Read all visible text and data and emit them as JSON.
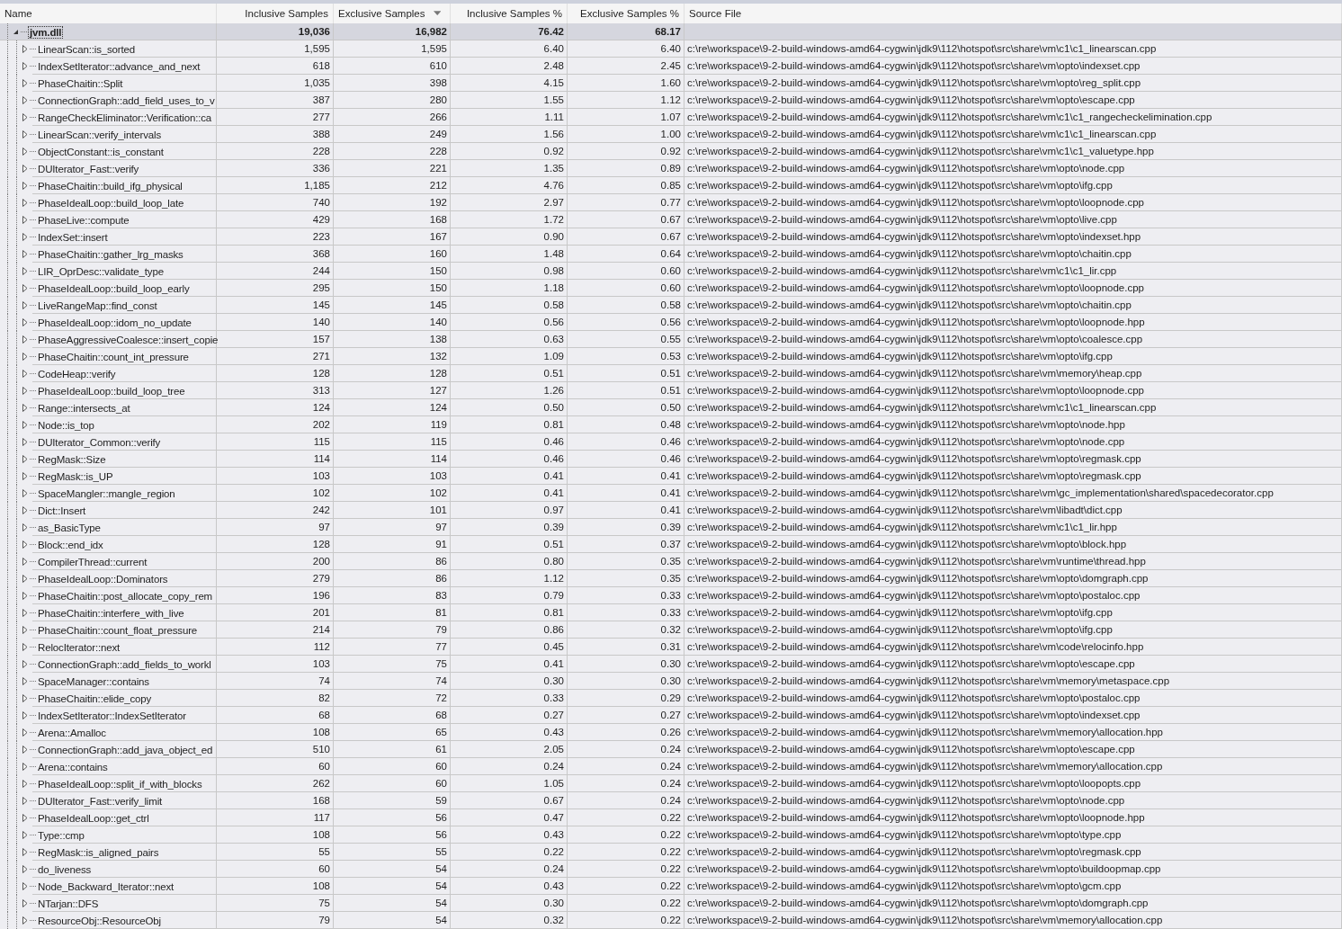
{
  "table": {
    "columns": [
      {
        "label": "Name",
        "sorted": false
      },
      {
        "label": "Inclusive Samples",
        "sorted": false
      },
      {
        "label": "Exclusive Samples",
        "sorted": true
      },
      {
        "label": "Inclusive Samples %",
        "sorted": false
      },
      {
        "label": "Exclusive Samples %",
        "sorted": false
      },
      {
        "label": "Source File",
        "sorted": false
      }
    ],
    "rows": [
      {
        "cells": [
          "jvm.dll",
          "19,036",
          "16,982",
          "76.42",
          "68.17",
          ""
        ],
        "expanded": true,
        "selected": true,
        "children": [
          {
            "cells": [
              "LinearScan::is_sorted",
              "1,595",
              "1,595",
              "6.40",
              "6.40",
              "c:\\re\\workspace\\9-2-build-windows-amd64-cygwin\\jdk9\\112\\hotspot\\src\\share\\vm\\c1\\c1_linearscan.cpp"
            ],
            "expanded": false,
            "selected": false
          },
          {
            "cells": [
              "IndexSetIterator::advance_and_next",
              "618",
              "610",
              "2.48",
              "2.45",
              "c:\\re\\workspace\\9-2-build-windows-amd64-cygwin\\jdk9\\112\\hotspot\\src\\share\\vm\\opto\\indexset.cpp"
            ],
            "expanded": false,
            "selected": false
          },
          {
            "cells": [
              "PhaseChaitin::Split",
              "1,035",
              "398",
              "4.15",
              "1.60",
              "c:\\re\\workspace\\9-2-build-windows-amd64-cygwin\\jdk9\\112\\hotspot\\src\\share\\vm\\opto\\reg_split.cpp"
            ],
            "expanded": false,
            "selected": false
          },
          {
            "cells": [
              "ConnectionGraph::add_field_uses_to_v",
              "387",
              "280",
              "1.55",
              "1.12",
              "c:\\re\\workspace\\9-2-build-windows-amd64-cygwin\\jdk9\\112\\hotspot\\src\\share\\vm\\opto\\escape.cpp"
            ],
            "expanded": false,
            "selected": false
          },
          {
            "cells": [
              "RangeCheckEliminator::Verification::ca",
              "277",
              "266",
              "1.11",
              "1.07",
              "c:\\re\\workspace\\9-2-build-windows-amd64-cygwin\\jdk9\\112\\hotspot\\src\\share\\vm\\c1\\c1_rangecheckelimination.cpp"
            ],
            "expanded": false,
            "selected": false
          },
          {
            "cells": [
              "LinearScan::verify_intervals",
              "388",
              "249",
              "1.56",
              "1.00",
              "c:\\re\\workspace\\9-2-build-windows-amd64-cygwin\\jdk9\\112\\hotspot\\src\\share\\vm\\c1\\c1_linearscan.cpp"
            ],
            "expanded": false,
            "selected": false
          },
          {
            "cells": [
              "ObjectConstant::is_constant",
              "228",
              "228",
              "0.92",
              "0.92",
              "c:\\re\\workspace\\9-2-build-windows-amd64-cygwin\\jdk9\\112\\hotspot\\src\\share\\vm\\c1\\c1_valuetype.hpp"
            ],
            "expanded": false,
            "selected": false
          },
          {
            "cells": [
              "DUIterator_Fast::verify",
              "336",
              "221",
              "1.35",
              "0.89",
              "c:\\re\\workspace\\9-2-build-windows-amd64-cygwin\\jdk9\\112\\hotspot\\src\\share\\vm\\opto\\node.cpp"
            ],
            "expanded": false,
            "selected": false
          },
          {
            "cells": [
              "PhaseChaitin::build_ifg_physical",
              "1,185",
              "212",
              "4.76",
              "0.85",
              "c:\\re\\workspace\\9-2-build-windows-amd64-cygwin\\jdk9\\112\\hotspot\\src\\share\\vm\\opto\\ifg.cpp"
            ],
            "expanded": false,
            "selected": false
          },
          {
            "cells": [
              "PhaseIdealLoop::build_loop_late",
              "740",
              "192",
              "2.97",
              "0.77",
              "c:\\re\\workspace\\9-2-build-windows-amd64-cygwin\\jdk9\\112\\hotspot\\src\\share\\vm\\opto\\loopnode.cpp"
            ],
            "expanded": false,
            "selected": false
          },
          {
            "cells": [
              "PhaseLive::compute",
              "429",
              "168",
              "1.72",
              "0.67",
              "c:\\re\\workspace\\9-2-build-windows-amd64-cygwin\\jdk9\\112\\hotspot\\src\\share\\vm\\opto\\live.cpp"
            ],
            "expanded": false,
            "selected": false
          },
          {
            "cells": [
              "IndexSet::insert",
              "223",
              "167",
              "0.90",
              "0.67",
              "c:\\re\\workspace\\9-2-build-windows-amd64-cygwin\\jdk9\\112\\hotspot\\src\\share\\vm\\opto\\indexset.hpp"
            ],
            "expanded": false,
            "selected": false
          },
          {
            "cells": [
              "PhaseChaitin::gather_lrg_masks",
              "368",
              "160",
              "1.48",
              "0.64",
              "c:\\re\\workspace\\9-2-build-windows-amd64-cygwin\\jdk9\\112\\hotspot\\src\\share\\vm\\opto\\chaitin.cpp"
            ],
            "expanded": false,
            "selected": false
          },
          {
            "cells": [
              "LIR_OprDesc::validate_type",
              "244",
              "150",
              "0.98",
              "0.60",
              "c:\\re\\workspace\\9-2-build-windows-amd64-cygwin\\jdk9\\112\\hotspot\\src\\share\\vm\\c1\\c1_lir.cpp"
            ],
            "expanded": false,
            "selected": false
          },
          {
            "cells": [
              "PhaseIdealLoop::build_loop_early",
              "295",
              "150",
              "1.18",
              "0.60",
              "c:\\re\\workspace\\9-2-build-windows-amd64-cygwin\\jdk9\\112\\hotspot\\src\\share\\vm\\opto\\loopnode.cpp"
            ],
            "expanded": false,
            "selected": false
          },
          {
            "cells": [
              "LiveRangeMap::find_const",
              "145",
              "145",
              "0.58",
              "0.58",
              "c:\\re\\workspace\\9-2-build-windows-amd64-cygwin\\jdk9\\112\\hotspot\\src\\share\\vm\\opto\\chaitin.cpp"
            ],
            "expanded": false,
            "selected": false
          },
          {
            "cells": [
              "PhaseIdealLoop::idom_no_update",
              "140",
              "140",
              "0.56",
              "0.56",
              "c:\\re\\workspace\\9-2-build-windows-amd64-cygwin\\jdk9\\112\\hotspot\\src\\share\\vm\\opto\\loopnode.hpp"
            ],
            "expanded": false,
            "selected": false
          },
          {
            "cells": [
              "PhaseAggressiveCoalesce::insert_copie",
              "157",
              "138",
              "0.63",
              "0.55",
              "c:\\re\\workspace\\9-2-build-windows-amd64-cygwin\\jdk9\\112\\hotspot\\src\\share\\vm\\opto\\coalesce.cpp"
            ],
            "expanded": false,
            "selected": false
          },
          {
            "cells": [
              "PhaseChaitin::count_int_pressure",
              "271",
              "132",
              "1.09",
              "0.53",
              "c:\\re\\workspace\\9-2-build-windows-amd64-cygwin\\jdk9\\112\\hotspot\\src\\share\\vm\\opto\\ifg.cpp"
            ],
            "expanded": false,
            "selected": false
          },
          {
            "cells": [
              "CodeHeap::verify",
              "128",
              "128",
              "0.51",
              "0.51",
              "c:\\re\\workspace\\9-2-build-windows-amd64-cygwin\\jdk9\\112\\hotspot\\src\\share\\vm\\memory\\heap.cpp"
            ],
            "expanded": false,
            "selected": false
          },
          {
            "cells": [
              "PhaseIdealLoop::build_loop_tree",
              "313",
              "127",
              "1.26",
              "0.51",
              "c:\\re\\workspace\\9-2-build-windows-amd64-cygwin\\jdk9\\112\\hotspot\\src\\share\\vm\\opto\\loopnode.cpp"
            ],
            "expanded": false,
            "selected": false
          },
          {
            "cells": [
              "Range::intersects_at",
              "124",
              "124",
              "0.50",
              "0.50",
              "c:\\re\\workspace\\9-2-build-windows-amd64-cygwin\\jdk9\\112\\hotspot\\src\\share\\vm\\c1\\c1_linearscan.cpp"
            ],
            "expanded": false,
            "selected": false
          },
          {
            "cells": [
              "Node::is_top",
              "202",
              "119",
              "0.81",
              "0.48",
              "c:\\re\\workspace\\9-2-build-windows-amd64-cygwin\\jdk9\\112\\hotspot\\src\\share\\vm\\opto\\node.hpp"
            ],
            "expanded": false,
            "selected": false
          },
          {
            "cells": [
              "DUIterator_Common::verify",
              "115",
              "115",
              "0.46",
              "0.46",
              "c:\\re\\workspace\\9-2-build-windows-amd64-cygwin\\jdk9\\112\\hotspot\\src\\share\\vm\\opto\\node.cpp"
            ],
            "expanded": false,
            "selected": false
          },
          {
            "cells": [
              "RegMask::Size",
              "114",
              "114",
              "0.46",
              "0.46",
              "c:\\re\\workspace\\9-2-build-windows-amd64-cygwin\\jdk9\\112\\hotspot\\src\\share\\vm\\opto\\regmask.cpp"
            ],
            "expanded": false,
            "selected": false
          },
          {
            "cells": [
              "RegMask::is_UP",
              "103",
              "103",
              "0.41",
              "0.41",
              "c:\\re\\workspace\\9-2-build-windows-amd64-cygwin\\jdk9\\112\\hotspot\\src\\share\\vm\\opto\\regmask.cpp"
            ],
            "expanded": false,
            "selected": false
          },
          {
            "cells": [
              "SpaceMangler::mangle_region",
              "102",
              "102",
              "0.41",
              "0.41",
              "c:\\re\\workspace\\9-2-build-windows-amd64-cygwin\\jdk9\\112\\hotspot\\src\\share\\vm\\gc_implementation\\shared\\spacedecorator.cpp"
            ],
            "expanded": false,
            "selected": false
          },
          {
            "cells": [
              "Dict::Insert",
              "242",
              "101",
              "0.97",
              "0.41",
              "c:\\re\\workspace\\9-2-build-windows-amd64-cygwin\\jdk9\\112\\hotspot\\src\\share\\vm\\libadt\\dict.cpp"
            ],
            "expanded": false,
            "selected": false
          },
          {
            "cells": [
              "as_BasicType",
              "97",
              "97",
              "0.39",
              "0.39",
              "c:\\re\\workspace\\9-2-build-windows-amd64-cygwin\\jdk9\\112\\hotspot\\src\\share\\vm\\c1\\c1_lir.hpp"
            ],
            "expanded": false,
            "selected": false
          },
          {
            "cells": [
              "Block::end_idx",
              "128",
              "91",
              "0.51",
              "0.37",
              "c:\\re\\workspace\\9-2-build-windows-amd64-cygwin\\jdk9\\112\\hotspot\\src\\share\\vm\\opto\\block.hpp"
            ],
            "expanded": false,
            "selected": false
          },
          {
            "cells": [
              "CompilerThread::current",
              "200",
              "86",
              "0.80",
              "0.35",
              "c:\\re\\workspace\\9-2-build-windows-amd64-cygwin\\jdk9\\112\\hotspot\\src\\share\\vm\\runtime\\thread.hpp"
            ],
            "expanded": false,
            "selected": false
          },
          {
            "cells": [
              "PhaseIdealLoop::Dominators",
              "279",
              "86",
              "1.12",
              "0.35",
              "c:\\re\\workspace\\9-2-build-windows-amd64-cygwin\\jdk9\\112\\hotspot\\src\\share\\vm\\opto\\domgraph.cpp"
            ],
            "expanded": false,
            "selected": false
          },
          {
            "cells": [
              "PhaseChaitin::post_allocate_copy_rem",
              "196",
              "83",
              "0.79",
              "0.33",
              "c:\\re\\workspace\\9-2-build-windows-amd64-cygwin\\jdk9\\112\\hotspot\\src\\share\\vm\\opto\\postaloc.cpp"
            ],
            "expanded": false,
            "selected": false
          },
          {
            "cells": [
              "PhaseChaitin::interfere_with_live",
              "201",
              "81",
              "0.81",
              "0.33",
              "c:\\re\\workspace\\9-2-build-windows-amd64-cygwin\\jdk9\\112\\hotspot\\src\\share\\vm\\opto\\ifg.cpp"
            ],
            "expanded": false,
            "selected": false
          },
          {
            "cells": [
              "PhaseChaitin::count_float_pressure",
              "214",
              "79",
              "0.86",
              "0.32",
              "c:\\re\\workspace\\9-2-build-windows-amd64-cygwin\\jdk9\\112\\hotspot\\src\\share\\vm\\opto\\ifg.cpp"
            ],
            "expanded": false,
            "selected": false
          },
          {
            "cells": [
              "RelocIterator::next",
              "112",
              "77",
              "0.45",
              "0.31",
              "c:\\re\\workspace\\9-2-build-windows-amd64-cygwin\\jdk9\\112\\hotspot\\src\\share\\vm\\code\\relocinfo.hpp"
            ],
            "expanded": false,
            "selected": false
          },
          {
            "cells": [
              "ConnectionGraph::add_fields_to_workl",
              "103",
              "75",
              "0.41",
              "0.30",
              "c:\\re\\workspace\\9-2-build-windows-amd64-cygwin\\jdk9\\112\\hotspot\\src\\share\\vm\\opto\\escape.cpp"
            ],
            "expanded": false,
            "selected": false
          },
          {
            "cells": [
              "SpaceManager::contains",
              "74",
              "74",
              "0.30",
              "0.30",
              "c:\\re\\workspace\\9-2-build-windows-amd64-cygwin\\jdk9\\112\\hotspot\\src\\share\\vm\\memory\\metaspace.cpp"
            ],
            "expanded": false,
            "selected": false
          },
          {
            "cells": [
              "PhaseChaitin::elide_copy",
              "82",
              "72",
              "0.33",
              "0.29",
              "c:\\re\\workspace\\9-2-build-windows-amd64-cygwin\\jdk9\\112\\hotspot\\src\\share\\vm\\opto\\postaloc.cpp"
            ],
            "expanded": false,
            "selected": false
          },
          {
            "cells": [
              "IndexSetIterator::IndexSetIterator",
              "68",
              "68",
              "0.27",
              "0.27",
              "c:\\re\\workspace\\9-2-build-windows-amd64-cygwin\\jdk9\\112\\hotspot\\src\\share\\vm\\opto\\indexset.cpp"
            ],
            "expanded": false,
            "selected": false
          },
          {
            "cells": [
              "Arena::Amalloc",
              "108",
              "65",
              "0.43",
              "0.26",
              "c:\\re\\workspace\\9-2-build-windows-amd64-cygwin\\jdk9\\112\\hotspot\\src\\share\\vm\\memory\\allocation.hpp"
            ],
            "expanded": false,
            "selected": false
          },
          {
            "cells": [
              "ConnectionGraph::add_java_object_ed",
              "510",
              "61",
              "2.05",
              "0.24",
              "c:\\re\\workspace\\9-2-build-windows-amd64-cygwin\\jdk9\\112\\hotspot\\src\\share\\vm\\opto\\escape.cpp"
            ],
            "expanded": false,
            "selected": false
          },
          {
            "cells": [
              "Arena::contains",
              "60",
              "60",
              "0.24",
              "0.24",
              "c:\\re\\workspace\\9-2-build-windows-amd64-cygwin\\jdk9\\112\\hotspot\\src\\share\\vm\\memory\\allocation.cpp"
            ],
            "expanded": false,
            "selected": false
          },
          {
            "cells": [
              "PhaseIdealLoop::split_if_with_blocks",
              "262",
              "60",
              "1.05",
              "0.24",
              "c:\\re\\workspace\\9-2-build-windows-amd64-cygwin\\jdk9\\112\\hotspot\\src\\share\\vm\\opto\\loopopts.cpp"
            ],
            "expanded": false,
            "selected": false
          },
          {
            "cells": [
              "DUIterator_Fast::verify_limit",
              "168",
              "59",
              "0.67",
              "0.24",
              "c:\\re\\workspace\\9-2-build-windows-amd64-cygwin\\jdk9\\112\\hotspot\\src\\share\\vm\\opto\\node.cpp"
            ],
            "expanded": false,
            "selected": false
          },
          {
            "cells": [
              "PhaseIdealLoop::get_ctrl",
              "117",
              "56",
              "0.47",
              "0.22",
              "c:\\re\\workspace\\9-2-build-windows-amd64-cygwin\\jdk9\\112\\hotspot\\src\\share\\vm\\opto\\loopnode.hpp"
            ],
            "expanded": false,
            "selected": false
          },
          {
            "cells": [
              "Type::cmp",
              "108",
              "56",
              "0.43",
              "0.22",
              "c:\\re\\workspace\\9-2-build-windows-amd64-cygwin\\jdk9\\112\\hotspot\\src\\share\\vm\\opto\\type.cpp"
            ],
            "expanded": false,
            "selected": false
          },
          {
            "cells": [
              "RegMask::is_aligned_pairs",
              "55",
              "55",
              "0.22",
              "0.22",
              "c:\\re\\workspace\\9-2-build-windows-amd64-cygwin\\jdk9\\112\\hotspot\\src\\share\\vm\\opto\\regmask.cpp"
            ],
            "expanded": false,
            "selected": false
          },
          {
            "cells": [
              "do_liveness",
              "60",
              "54",
              "0.24",
              "0.22",
              "c:\\re\\workspace\\9-2-build-windows-amd64-cygwin\\jdk9\\112\\hotspot\\src\\share\\vm\\opto\\buildoopmap.cpp"
            ],
            "expanded": false,
            "selected": false
          },
          {
            "cells": [
              "Node_Backward_Iterator::next",
              "108",
              "54",
              "0.43",
              "0.22",
              "c:\\re\\workspace\\9-2-build-windows-amd64-cygwin\\jdk9\\112\\hotspot\\src\\share\\vm\\opto\\gcm.cpp"
            ],
            "expanded": false,
            "selected": false
          },
          {
            "cells": [
              "NTarjan::DFS",
              "75",
              "54",
              "0.30",
              "0.22",
              "c:\\re\\workspace\\9-2-build-windows-amd64-cygwin\\jdk9\\112\\hotspot\\src\\share\\vm\\opto\\domgraph.cpp"
            ],
            "expanded": false,
            "selected": false
          },
          {
            "cells": [
              "ResourceObj::ResourceObj",
              "79",
              "54",
              "0.32",
              "0.22",
              "c:\\re\\workspace\\9-2-build-windows-amd64-cygwin\\jdk9\\112\\hotspot\\src\\share\\vm\\memory\\allocation.cpp"
            ],
            "expanded": false,
            "selected": false
          }
        ]
      }
    ]
  }
}
